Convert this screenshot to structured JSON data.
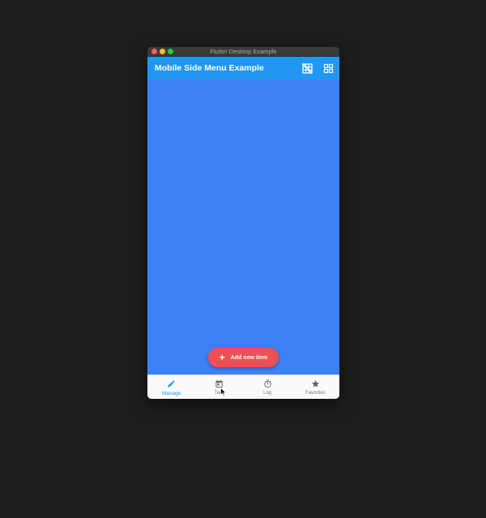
{
  "window": {
    "title": "Flutter Desktop Example"
  },
  "appbar": {
    "title": "Mobile Side Menu Example",
    "actions": [
      {
        "icon": "grid-off-icon"
      },
      {
        "icon": "grid-view-icon"
      }
    ]
  },
  "fab": {
    "label": "Add new item",
    "icon": "plus-icon"
  },
  "bottom_nav": {
    "items": [
      {
        "label": "Manage",
        "icon": "pencil-icon",
        "active": true
      },
      {
        "label": "Task",
        "icon": "calendar-icon",
        "active": false
      },
      {
        "label": "Log",
        "icon": "timer-icon",
        "active": false
      },
      {
        "label": "Favorites",
        "icon": "star-icon",
        "active": false
      }
    ]
  },
  "colors": {
    "background": "#1e1e1f",
    "appbar": "#2196f3",
    "content": "#3e81f6",
    "fab": "#ef4f55",
    "nav_active": "#2196f3",
    "nav_inactive": "#757575"
  }
}
